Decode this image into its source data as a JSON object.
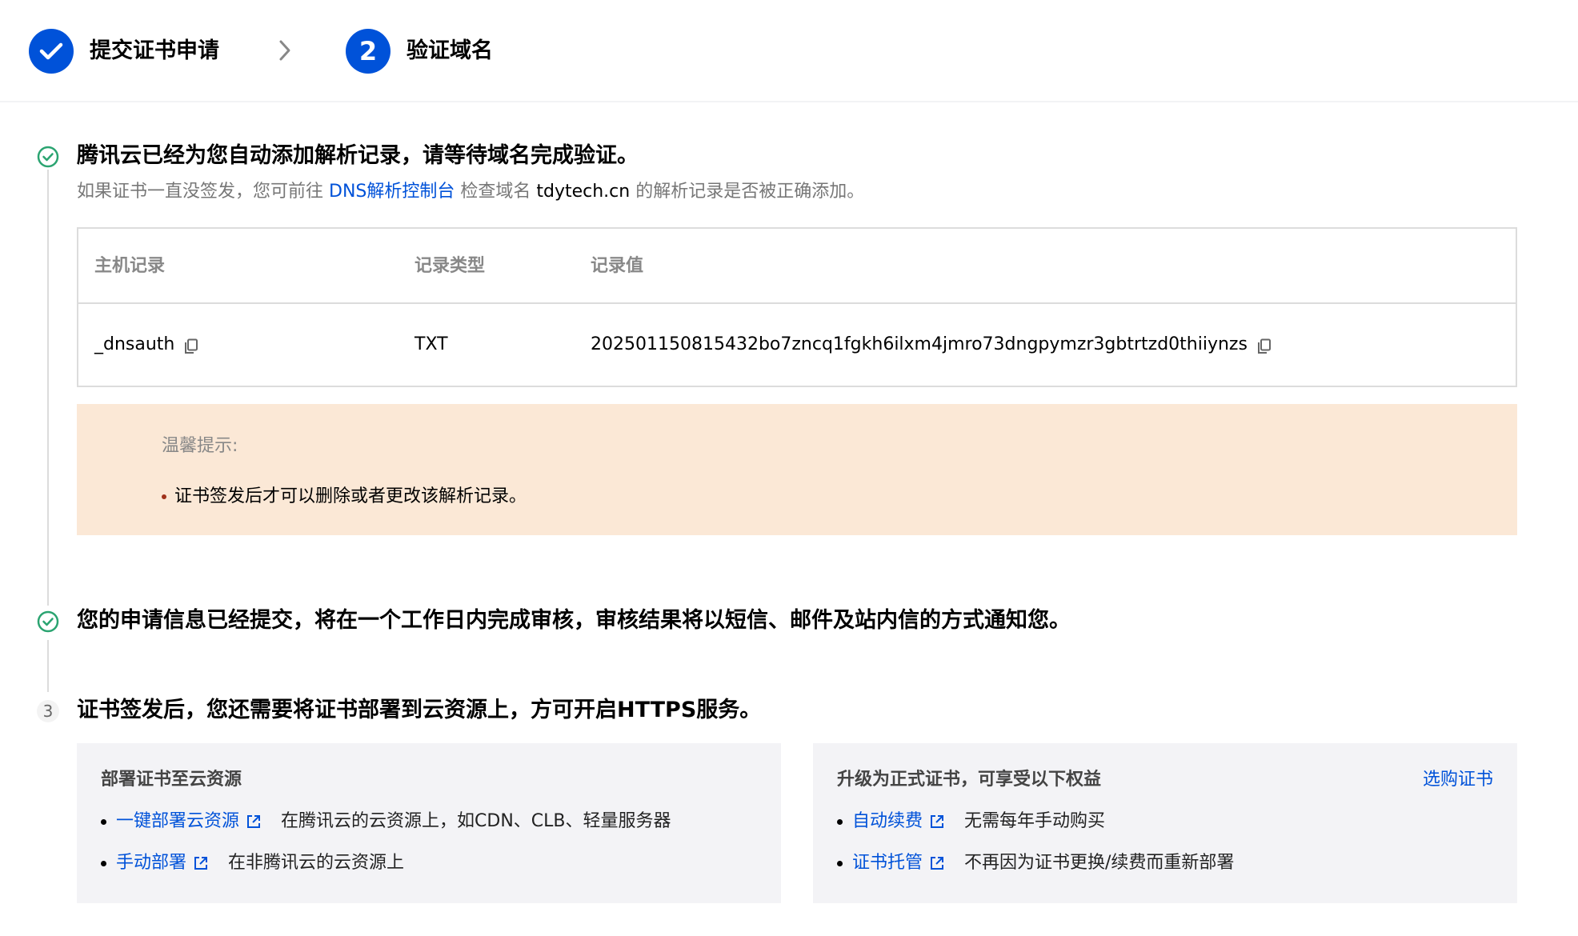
{
  "stepper": {
    "step1": {
      "label": "提交证书申请",
      "status": "done"
    },
    "step2": {
      "number": "2",
      "label": "验证域名",
      "status": "current"
    }
  },
  "section1": {
    "title": "腾讯云已经为您自动添加解析记录，请等待域名完成验证。",
    "desc_prefix": "如果证书一直没签发，您可前往 ",
    "desc_link": "DNS解析控制台",
    "desc_mid": " 检查域名 ",
    "desc_domain": "tdytech.cn",
    "desc_suffix": " 的解析记录是否被正确添加。"
  },
  "record_table": {
    "headers": [
      "主机记录",
      "记录类型",
      "记录值"
    ],
    "row": {
      "host": "_dnsauth",
      "type": "TXT",
      "value": "202501150815432bo7zncq1fgkh6ilxm4jmro73dngpymzr3gbtrtzd0thiiynzs"
    }
  },
  "tip": {
    "title": "温馨提示:",
    "items": [
      "证书签发后才可以删除或者更改该解析记录。"
    ]
  },
  "section2": {
    "title": "您的申请信息已经提交，将在一个工作日内完成审核，审核结果将以短信、邮件及站内信的方式通知您。"
  },
  "section3": {
    "number": "3",
    "title": "证书签发后，您还需要将证书部署到云资源上，方可开启HTTPS服务。"
  },
  "panel_deploy": {
    "title": "部署证书至云资源",
    "items": [
      {
        "link": "一键部署云资源",
        "desc": "在腾讯云的云资源上，如CDN、CLB、轻量服务器"
      },
      {
        "link": "手动部署",
        "desc": "在非腾讯云的云资源上"
      }
    ]
  },
  "panel_upgrade": {
    "title": "升级为正式证书，可享受以下权益",
    "action": "选购证书",
    "items": [
      {
        "link": "自动续费",
        "desc": "无需每年手动购买"
      },
      {
        "link": "证书托管",
        "desc": "不再因为证书更换/续费而重新部署"
      }
    ]
  },
  "colors": {
    "primary": "#0052d9",
    "success": "#2ba471",
    "tip_bg": "#fbe8d6",
    "panel_bg": "#f3f3f6"
  },
  "icons": [
    "check-icon",
    "chevron-right-icon",
    "check-circle-icon",
    "copy-icon",
    "external-link-icon"
  ]
}
